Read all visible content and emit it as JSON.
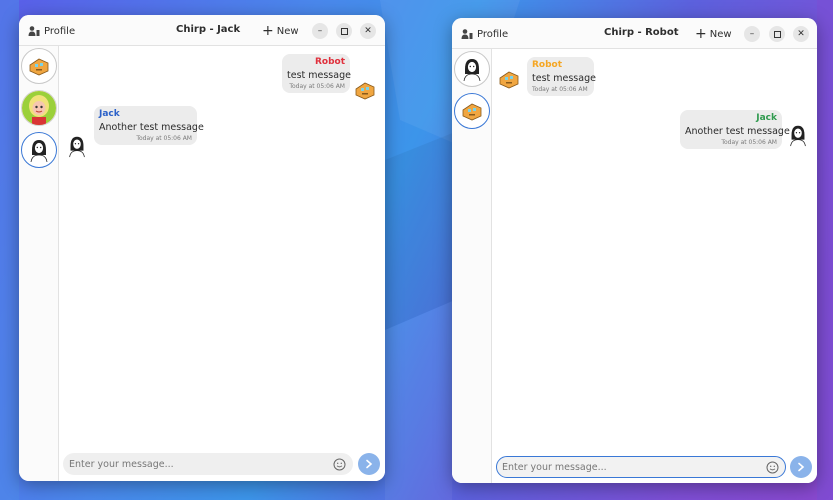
{
  "colors": {
    "accent": "#3a78d6",
    "robot_name": "#e0303c",
    "robot_name_alt": "#f5a623",
    "jack_name": "#2a60c8",
    "jack_name_alt": "#2f9a4e",
    "bubble_bg": "#ececec",
    "send_button": "#8ab3ea"
  },
  "left_window": {
    "profile_label": "Profile",
    "title": "Chirp - Jack",
    "new_label": "New",
    "contacts": [
      {
        "name": "robot",
        "icon": "robot-avatar-icon",
        "active": false
      },
      {
        "name": "blonde-person",
        "icon": "blonde-avatar-icon",
        "active": false
      },
      {
        "name": "jack",
        "icon": "jack-avatar-icon",
        "active": true
      }
    ],
    "messages": [
      {
        "sender": "Robot",
        "text": "test message",
        "time": "Today at 05:06 AM",
        "side": "right"
      },
      {
        "sender": "Jack",
        "text": "Another test message",
        "time": "Today at 05:06 AM",
        "side": "left"
      }
    ],
    "input_placeholder": "Enter your message..."
  },
  "right_window": {
    "profile_label": "Profile",
    "title": "Chirp - Robot",
    "new_label": "New",
    "contacts": [
      {
        "name": "jack",
        "icon": "jack-avatar-icon",
        "active": false
      },
      {
        "name": "robot",
        "icon": "robot-avatar-icon",
        "active": true
      }
    ],
    "messages": [
      {
        "sender": "Robot",
        "text": "test message",
        "time": "Today at 05:06 AM",
        "side": "left"
      },
      {
        "sender": "Jack",
        "text": "Another test message",
        "time": "Today at 05:06 AM",
        "side": "right"
      }
    ],
    "input_placeholder": "Enter your message..."
  }
}
